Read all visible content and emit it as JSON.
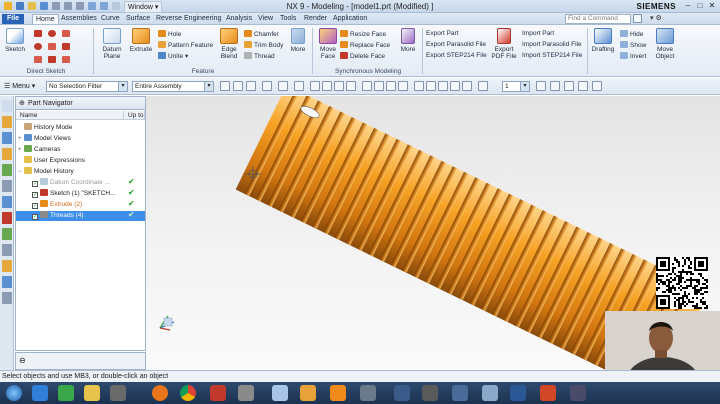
{
  "window": {
    "title": "NX 9 - Modeling - [model1.prt (Modified) ]",
    "brand": "SIEMENS",
    "window_menu": "Window",
    "controls": [
      "–",
      "□",
      "✕"
    ]
  },
  "menubar": {
    "tabs": [
      "File",
      "Home",
      "Assemblies",
      "Curve",
      "Surface",
      "Reverse Engineering",
      "Analysis",
      "View",
      "Tools",
      "Render",
      "Application"
    ],
    "active_tab": "Home",
    "find_command_placeholder": "Find a Command"
  },
  "ribbon": {
    "direct_sketch": {
      "label": "Direct Sketch",
      "sketch": "Sketch"
    },
    "feature": {
      "label": "Feature",
      "datum_plane": "Datum Plane",
      "extrude": "Extrude",
      "hole": "Hole",
      "pattern_feature": "Pattern Feature",
      "unite": "Unite",
      "edge_blend": "Edge Blend",
      "chamfer": "Chamfer",
      "trim_body": "Trim Body",
      "thread": "Thread",
      "more": "More"
    },
    "synchronous": {
      "label": "Synchronous Modeling",
      "move_face": "Move Face",
      "resize_face": "Resize Face",
      "replace_face": "Replace Face",
      "delete_face": "Delete Face",
      "more": "More"
    },
    "export": {
      "export_part": "Export Part",
      "export_parasolid": "Export Parasolid File",
      "export_step": "Export STEP214 File",
      "export_pdf": "Export PDF File",
      "import_part": "Import Part",
      "import_parasolid": "Import Parasolid File",
      "import_step": "Import STEP214 File"
    },
    "display": {
      "drafting": "Drafting",
      "hide": "Hide",
      "show": "Show",
      "invert": "Invert",
      "move_object": "Move Object"
    }
  },
  "toolbar2": {
    "menu": "Menu",
    "selection_filter": "No Selection Filter",
    "scope": "Entire Assembly",
    "count": "1"
  },
  "navigator": {
    "title": "Part Navigator",
    "col_name": "Name",
    "col_upto": "Up to",
    "nodes": [
      {
        "label": "History Mode"
      },
      {
        "label": "Model Views"
      },
      {
        "label": "Cameras"
      },
      {
        "label": "User Expressions"
      },
      {
        "label": "Model History"
      },
      {
        "label": "Datum Coordinate ..."
      },
      {
        "label": "Sketch (1) \"SKETCH..."
      },
      {
        "label": "Extrude (2)"
      },
      {
        "label": "Threads (4)"
      }
    ]
  },
  "status": {
    "message": "Select objects and use MB3, or double-click an object"
  },
  "colors": {
    "accent": "#2a64b8",
    "thread": "#f29a1c",
    "selection": "#3d8ee8"
  }
}
